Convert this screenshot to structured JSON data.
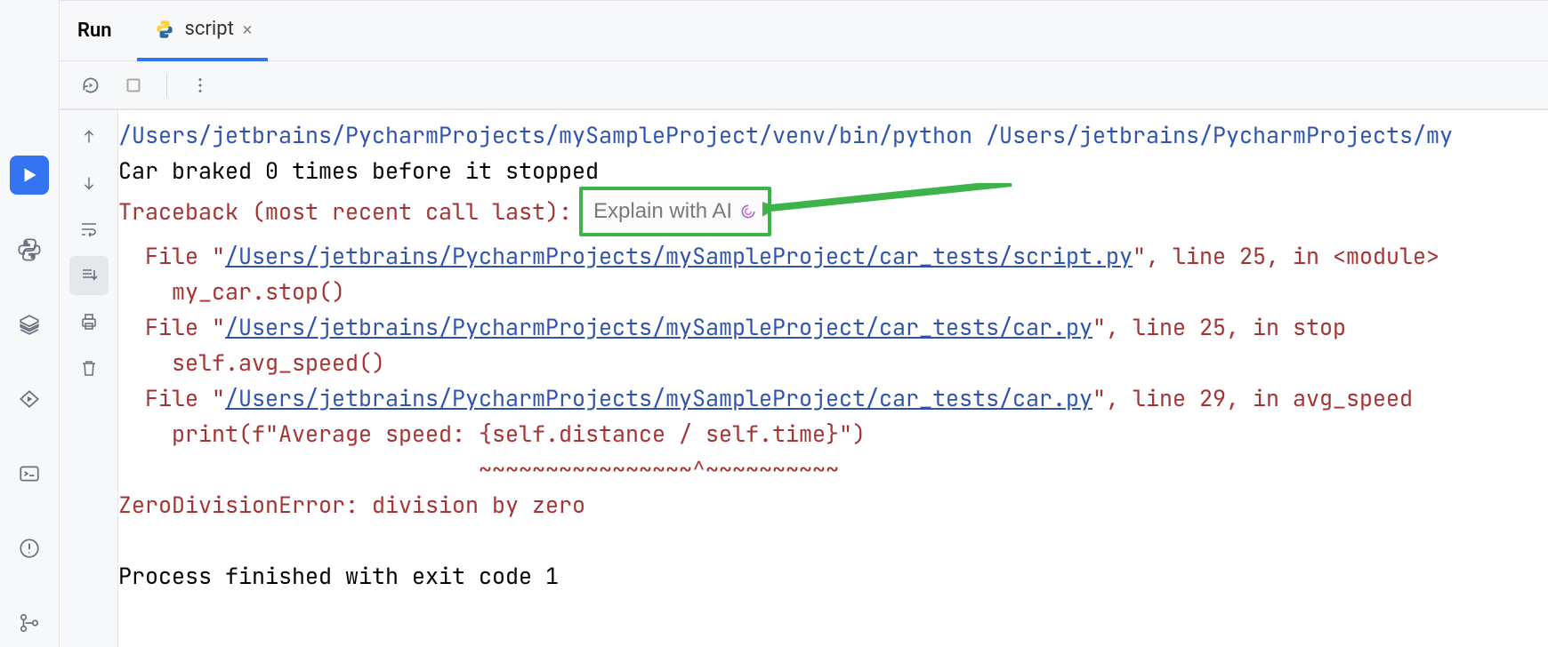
{
  "tabbar": {
    "title": "Run",
    "tab_label": "script"
  },
  "ai_inlay": {
    "label": "Explain with AI"
  },
  "console": {
    "cmd": "/Users/jetbrains/PycharmProjects/mySampleProject/venv/bin/python /Users/jetbrains/PycharmProjects/my",
    "out1": "Car braked 0 times before it stopped",
    "trace_head": "Traceback (most recent call last):",
    "f1_pre": "  File \"",
    "f1_link": "/Users/jetbrains/PycharmProjects/mySampleProject/car_tests/script.py",
    "f1_post": "\", line 25, in <module>",
    "f1_code": "    my_car.stop()",
    "f2_pre": "  File \"",
    "f2_link": "/Users/jetbrains/PycharmProjects/mySampleProject/car_tests/car.py",
    "f2_post": "\", line 25, in stop",
    "f2_code": "    self.avg_speed()",
    "f3_pre": "  File \"",
    "f3_link": "/Users/jetbrains/PycharmProjects/mySampleProject/car_tests/car.py",
    "f3_post": "\", line 29, in avg_speed",
    "f3_code": "    print(f\"Average speed: {self.distance / self.time}\")",
    "marker": "                           ~~~~~~~~~~~~~~~~^~~~~~~~~~~",
    "err": "ZeroDivisionError: division by zero",
    "blank": "",
    "exit": "Process finished with exit code 1"
  }
}
